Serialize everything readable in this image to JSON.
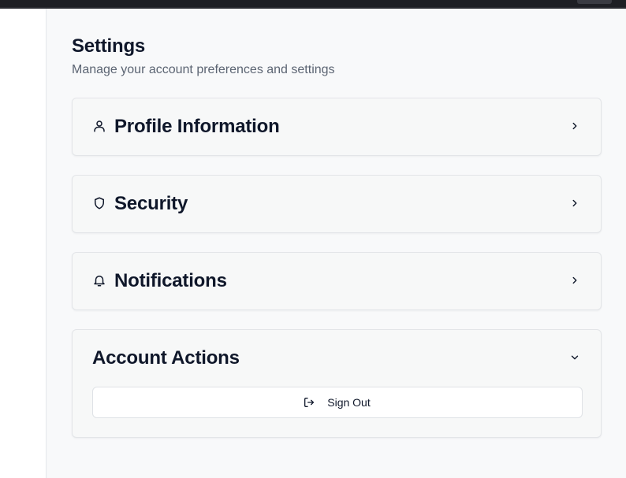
{
  "page": {
    "title": "Settings",
    "subtitle": "Manage your account preferences and settings"
  },
  "sections": [
    {
      "title": "Profile Information",
      "icon": "user-icon",
      "expanded": false
    },
    {
      "title": "Security",
      "icon": "shield-icon",
      "expanded": false
    },
    {
      "title": "Notifications",
      "icon": "bell-icon",
      "expanded": false
    },
    {
      "title": "Account Actions",
      "icon": "",
      "expanded": true
    }
  ],
  "account_actions": {
    "sign_out_label": "Sign Out",
    "sign_out_icon": "log-out-icon"
  },
  "colors": {
    "background": "#f8f9fa",
    "card": "#f7f8f8",
    "border": "#e3e5e8",
    "text": "#0f172a",
    "muted": "#5b6472"
  }
}
